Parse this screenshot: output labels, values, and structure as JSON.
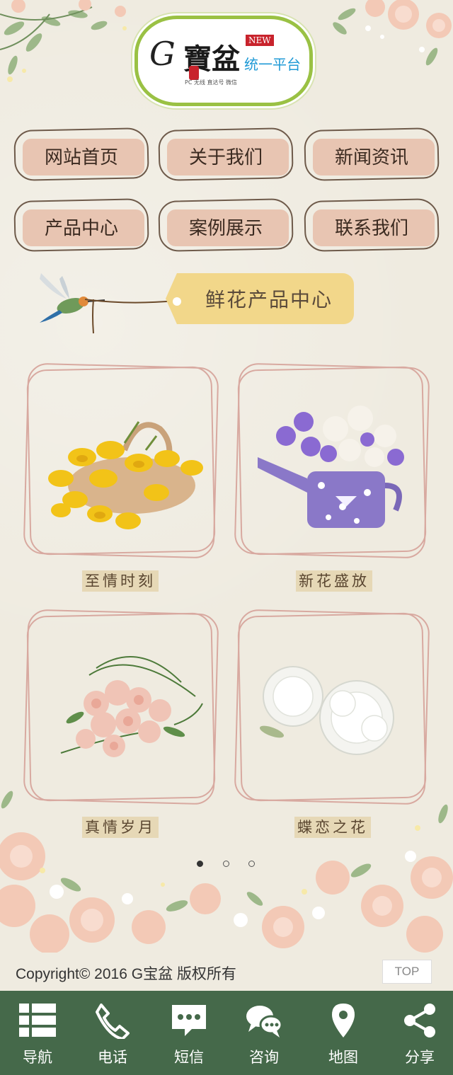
{
  "logo": {
    "mark": "G",
    "name": "寶盆",
    "badge": "NEW",
    "platform": "统一平台",
    "subtitle": "PC 无线 直达号 微信"
  },
  "nav": [
    {
      "label": "网站首页"
    },
    {
      "label": "关于我们"
    },
    {
      "label": "新闻资讯"
    },
    {
      "label": "产品中心"
    },
    {
      "label": "案例展示"
    },
    {
      "label": "联系我们"
    }
  ],
  "section": {
    "tag": "鲜花产品中心"
  },
  "products": [
    {
      "title": "至情时刻",
      "icon": "yellow-tulip-basket"
    },
    {
      "title": "新花盛放",
      "icon": "purple-watering-can-bouquet"
    },
    {
      "title": "真情岁月",
      "icon": "pink-rose-bouquet"
    },
    {
      "title": "蝶恋之花",
      "icon": "white-peonies"
    }
  ],
  "carousel": {
    "pages": 3,
    "active": 0
  },
  "footer": {
    "copyright": "Copyright© 2016  G宝盆 版权所有",
    "top_label": "TOP"
  },
  "toolbar": [
    {
      "label": "导航",
      "icon": "list-icon"
    },
    {
      "label": "电话",
      "icon": "phone-icon"
    },
    {
      "label": "短信",
      "icon": "sms-icon"
    },
    {
      "label": "咨询",
      "icon": "chat-icon"
    },
    {
      "label": "地图",
      "icon": "map-pin-icon"
    },
    {
      "label": "分享",
      "icon": "share-icon"
    }
  ],
  "colors": {
    "background": "#efebe0",
    "toolbar": "#45694a",
    "nav_fill": "#e7c1ae",
    "tag": "#f2d78a",
    "logo_border": "#9ac144",
    "platform_text": "#1f9ad6"
  }
}
